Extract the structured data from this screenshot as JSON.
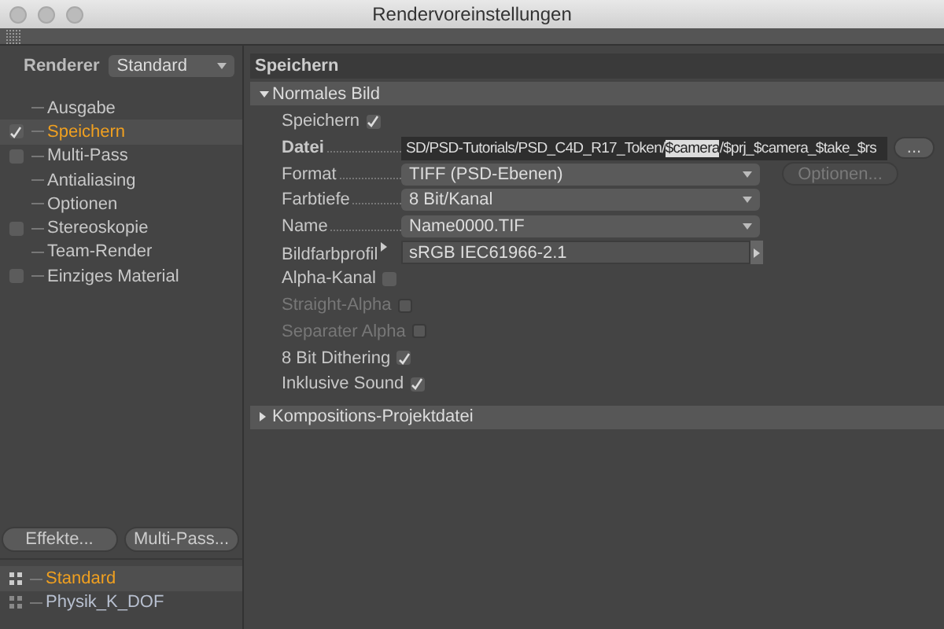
{
  "window": {
    "title": "Rendervoreinstellungen"
  },
  "renderer": {
    "label": "Renderer",
    "value": "Standard"
  },
  "sidebar": {
    "items": [
      {
        "label": "Ausgabe",
        "selected": false
      },
      {
        "label": "Speichern",
        "selected": true,
        "checked": true
      },
      {
        "label": "Multi-Pass",
        "selected": false,
        "checked": false
      },
      {
        "label": "Antialiasing",
        "selected": false
      },
      {
        "label": "Optionen",
        "selected": false
      },
      {
        "label": "Stereoskopie",
        "selected": false,
        "checked": false
      },
      {
        "label": "Team-Render",
        "selected": false
      },
      {
        "label": "Einziges Material",
        "selected": false,
        "checked": false
      }
    ]
  },
  "buttons": [
    "Effekte...",
    "Multi-Pass..."
  ],
  "presets": [
    {
      "label": "Standard",
      "selected": true
    },
    {
      "label": "Physik_K_DOF",
      "selected": false
    }
  ],
  "panel": {
    "title": "Speichern",
    "section": {
      "title": "Normales Bild",
      "expanded": true
    },
    "rows": [
      {
        "kind": "checkbox",
        "label": "Speichern",
        "checked": true,
        "disabled": false
      },
      {
        "kind": "path",
        "label": "Datei",
        "bold": true,
        "value_parts": [
          {
            "text": "SD/PSD-Tutorials/PSD_C4D_R17_Token/",
            "selected": false
          },
          {
            "text": "$camera",
            "selected": true
          },
          {
            "text": "/$prj_$camera_$take_$rs",
            "selected": false
          }
        ],
        "button": "..."
      },
      {
        "kind": "dropdown",
        "label": "Format",
        "value": "TIFF (PSD-Ebenen)",
        "button": "Optionen...",
        "button_disabled": true
      },
      {
        "kind": "dropdown",
        "label": "Farbtiefe",
        "value": "8 Bit/Kanal"
      },
      {
        "kind": "dropdown",
        "label": "Name",
        "value": "Name0000.TIF"
      },
      {
        "kind": "profile",
        "label": "Bildfarbprofil",
        "value": "sRGB IEC61966-2.1"
      },
      {
        "kind": "checkbox",
        "label": "Alpha-Kanal",
        "checked": false,
        "disabled": false
      },
      {
        "kind": "checkbox",
        "label": "Straight-Alpha",
        "checked": false,
        "disabled": true
      },
      {
        "kind": "checkbox",
        "label": "Separater Alpha",
        "checked": false,
        "disabled": true
      },
      {
        "kind": "checkbox",
        "label": "8 Bit Dithering",
        "checked": true,
        "disabled": false
      },
      {
        "kind": "checkbox",
        "label": "Inklusive Sound",
        "checked": true,
        "disabled": false
      }
    ],
    "collapsed_section": {
      "title": "Kompositions-Projektdatei",
      "expanded": false
    }
  }
}
